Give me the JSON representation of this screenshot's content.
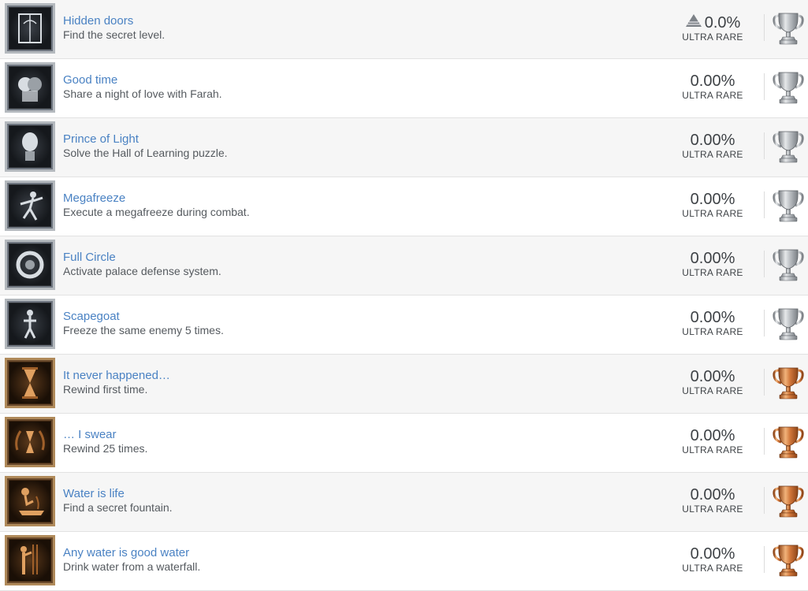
{
  "trophies": [
    {
      "name": "Hidden doors",
      "desc": "Find the secret level.",
      "percent": "0.0%",
      "rarity": "ULTRA RARE",
      "grade": "silver",
      "icon": "doors-icon",
      "show_triangle": true
    },
    {
      "name": "Good time",
      "desc": "Share a night of love with Farah.",
      "percent": "0.00%",
      "rarity": "ULTRA RARE",
      "grade": "silver",
      "icon": "kiss-icon",
      "show_triangle": false
    },
    {
      "name": "Prince of Light",
      "desc": "Solve the Hall of Learning puzzle.",
      "percent": "0.00%",
      "rarity": "ULTRA RARE",
      "grade": "silver",
      "icon": "statue-head-icon",
      "show_triangle": false
    },
    {
      "name": "Megafreeze",
      "desc": "Execute a megafreeze during combat.",
      "percent": "0.00%",
      "rarity": "ULTRA RARE",
      "grade": "silver",
      "icon": "combat-icon",
      "show_triangle": false
    },
    {
      "name": "Full Circle",
      "desc": "Activate palace defense system.",
      "percent": "0.00%",
      "rarity": "ULTRA RARE",
      "grade": "silver",
      "icon": "ring-icon",
      "show_triangle": false
    },
    {
      "name": "Scapegoat",
      "desc": "Freeze the same enemy 5 times.",
      "percent": "0.00%",
      "rarity": "ULTRA RARE",
      "grade": "silver",
      "icon": "enemy-icon",
      "show_triangle": false
    },
    {
      "name": "It never happened…",
      "desc": "Rewind first time.",
      "percent": "0.00%",
      "rarity": "ULTRA RARE",
      "grade": "bronze",
      "icon": "hourglass-icon",
      "show_triangle": false
    },
    {
      "name": "… I swear",
      "desc": "Rewind 25 times.",
      "percent": "0.00%",
      "rarity": "ULTRA RARE",
      "grade": "bronze",
      "icon": "laurel-hourglass-icon",
      "show_triangle": false
    },
    {
      "name": "Water is life",
      "desc": "Find a secret fountain.",
      "percent": "0.00%",
      "rarity": "ULTRA RARE",
      "grade": "bronze",
      "icon": "fountain-icon",
      "show_triangle": false
    },
    {
      "name": "Any water is good water",
      "desc": "Drink water from a waterfall.",
      "percent": "0.00%",
      "rarity": "ULTRA RARE",
      "grade": "bronze",
      "icon": "waterfall-icon",
      "show_triangle": false
    }
  ],
  "colors": {
    "link": "#4a82c3",
    "text": "#555a5f",
    "silver": "#a9aeb3",
    "bronze": "#c8733a",
    "row_alt": "#f6f6f6"
  }
}
